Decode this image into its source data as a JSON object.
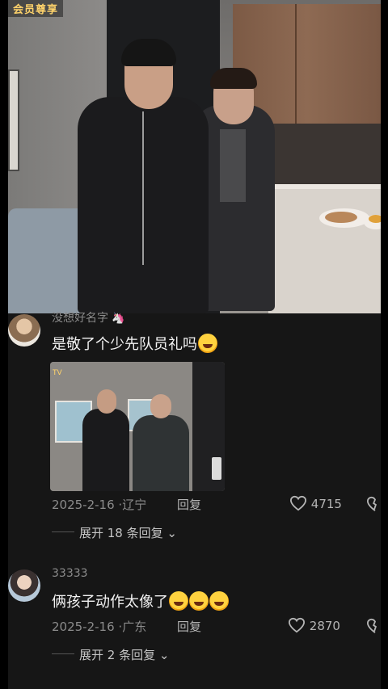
{
  "video": {
    "watermark": "会员尊享"
  },
  "comments": [
    {
      "username": "没想好名字",
      "username_badge": "🦄",
      "text": "是敬了个少先队员礼吗",
      "emojis": [
        "grinning-sweat"
      ],
      "has_image": true,
      "image_tag": "TV",
      "date": "2025-2-16",
      "location": "辽宁",
      "reply_label": "回复",
      "likes": "4715",
      "expand_label": "展开 18 条回复"
    },
    {
      "username": "33333",
      "text": "俩孩子动作太像了",
      "emojis": [
        "star-struck",
        "star-struck",
        "star-struck"
      ],
      "has_image": false,
      "date": "2025-2-16",
      "location": "广东",
      "reply_label": "回复",
      "likes": "2870",
      "expand_label": "展开 2 条回复"
    }
  ],
  "colors": {
    "background": "#161616",
    "watermark": "#ffd36b",
    "meta_text": "#8b8b8b",
    "body_text": "#f2f2f2"
  }
}
